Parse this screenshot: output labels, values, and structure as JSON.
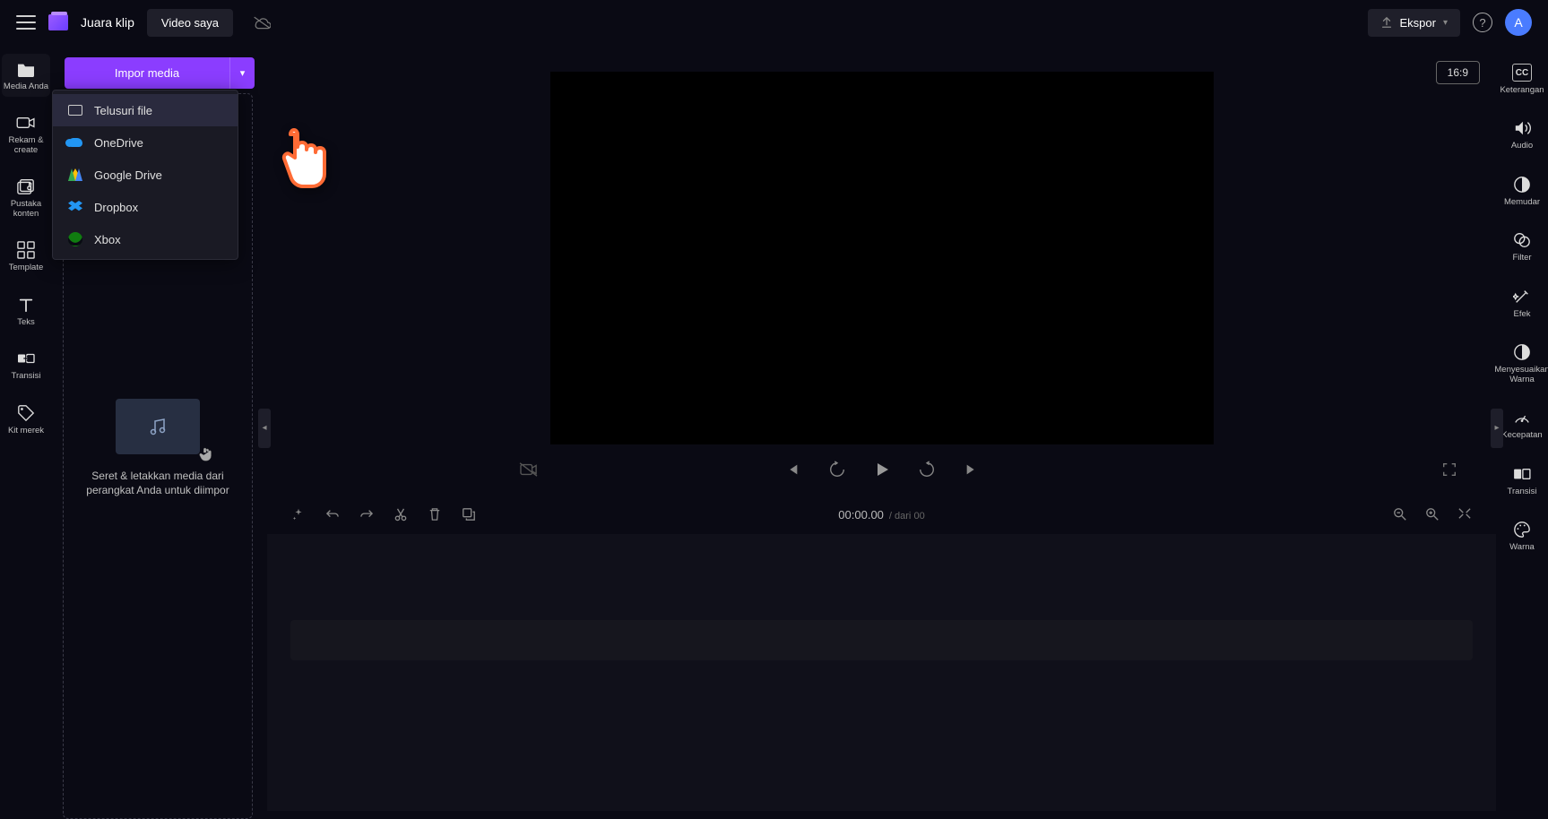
{
  "topbar": {
    "title": "Juara klip",
    "video_button": "Video saya",
    "export_label": "Ekspor",
    "avatar_letter": "A"
  },
  "left_rail": [
    {
      "key": "media",
      "label": "Media Anda"
    },
    {
      "key": "record",
      "label": "Rekam &amp; create"
    },
    {
      "key": "library",
      "label": "Pustaka konten"
    },
    {
      "key": "template",
      "label": "Template"
    },
    {
      "key": "text",
      "label": "Teks"
    },
    {
      "key": "transitions",
      "label": "Transisi"
    },
    {
      "key": "brandkit",
      "label": "Kit merek"
    }
  ],
  "import": {
    "button_label": "Impor media",
    "options": {
      "browse": "Telusuri file",
      "onedrive": "OneDrive",
      "gdrive": "Google Drive",
      "dropbox": "Dropbox",
      "xbox": "Xbox"
    }
  },
  "dropzone": {
    "text": "Seret &amp; letakkan media dari perangkat Anda untuk diimpor"
  },
  "preview": {
    "aspect_ratio": "16:9"
  },
  "timeline": {
    "current_time": "00:00.00",
    "duration_prefix": "/ dari",
    "duration": "00"
  },
  "right_rail": [
    {
      "key": "caption",
      "label": "Keterangan"
    },
    {
      "key": "audio",
      "label": "Audio"
    },
    {
      "key": "fade",
      "label": "Memudar"
    },
    {
      "key": "filter",
      "label": "Filter"
    },
    {
      "key": "effects",
      "label": "Efek"
    },
    {
      "key": "adjust",
      "label": "Menyesuaikan Warna"
    },
    {
      "key": "speed",
      "label": "Kecepatan"
    },
    {
      "key": "transition",
      "label": "Transisi"
    },
    {
      "key": "color",
      "label": "Warna"
    }
  ],
  "colors": {
    "accent": "#8b3dff",
    "bg": "#0a0a14"
  }
}
